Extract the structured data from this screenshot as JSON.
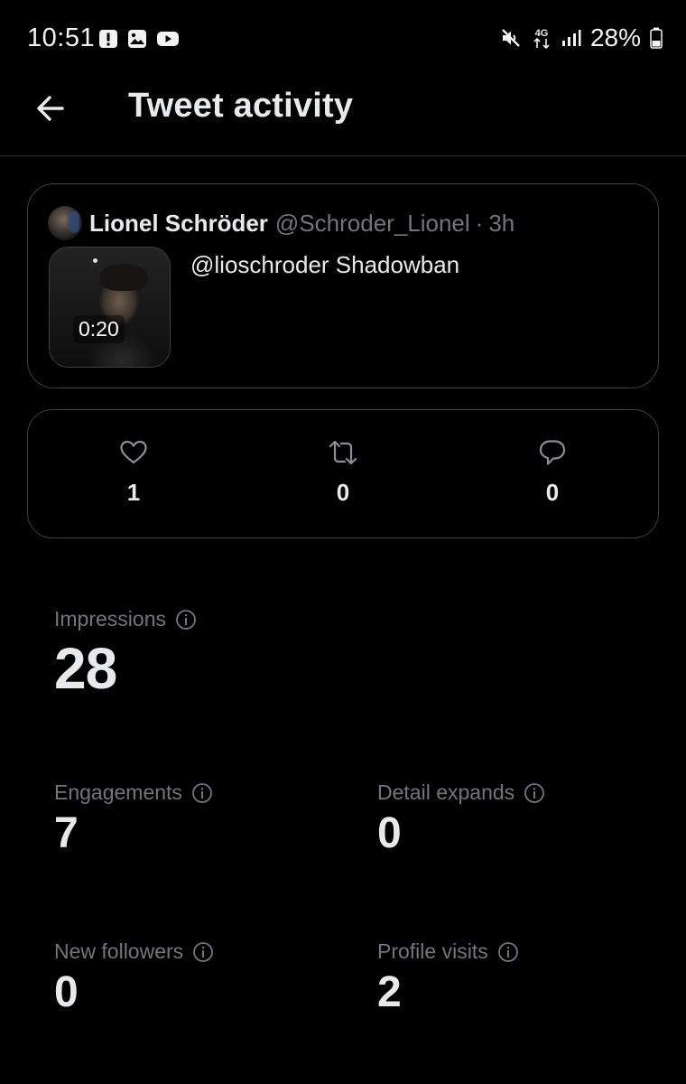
{
  "status_bar": {
    "time": "10:51",
    "left_icons": [
      "alert-icon",
      "image-icon",
      "youtube-icon"
    ],
    "right_icons": [
      "mute-icon",
      "network-4g-icon",
      "signal-icon",
      "battery-icon"
    ],
    "network_label": "4G",
    "battery": "28%"
  },
  "header": {
    "back_icon": "arrow-left-icon",
    "title": "Tweet activity"
  },
  "tweet": {
    "author_name": "Lionel Schröder",
    "handle": "@Schroder_Lionel",
    "separator": "·",
    "time": "3h",
    "text": "@lioschroder Shadowban",
    "video_duration": "0:20"
  },
  "engagement": {
    "likes": "1",
    "retweets": "0",
    "replies": "0"
  },
  "metrics": {
    "impressions": {
      "label": "Impressions",
      "value": "28"
    },
    "engagements": {
      "label": "Engagements",
      "value": "7"
    },
    "detail_expands": {
      "label": "Detail expands",
      "value": "0"
    },
    "new_followers": {
      "label": "New followers",
      "value": "0"
    },
    "profile_visits": {
      "label": "Profile visits",
      "value": "2"
    }
  },
  "colors": {
    "background": "#000000",
    "text_primary": "#e7e9ea",
    "text_secondary": "#71767b",
    "border": "#3a3f44"
  }
}
